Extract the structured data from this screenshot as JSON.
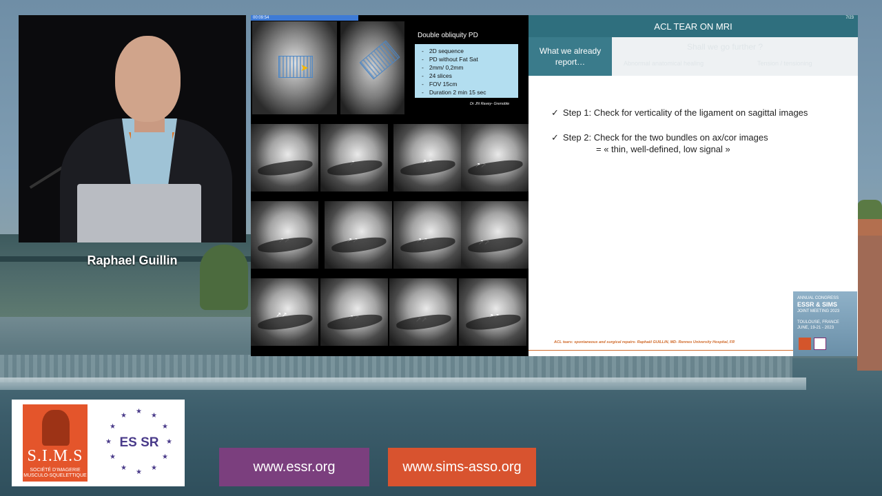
{
  "speaker": {
    "name": "Raphael Guillin"
  },
  "timer": "00:09:54",
  "mri_panel": {
    "caption": "Double obliquity PD",
    "params": [
      "2D sequence",
      "PD without Fat Sat",
      "2mm/ 0,2mm",
      "24 slices",
      "FOV 15cm",
      "Duration 2 min 15 sec"
    ],
    "credit": "Dr JN Ravey- Grenoble"
  },
  "slide": {
    "title": "ACL TEAR ON MRI",
    "counter": "7/23",
    "tab_active": "What we already report…",
    "tab_faded_title": "Shall we go further ?",
    "tab_faded_1": "Abnormal anatomical healing",
    "tab_faded_2": "Tension / tensioning",
    "step1": "Step 1: Check for verticality of the ligament on sagittal images",
    "step2": "Step 2: Check for the two bundles on ax/cor images",
    "step2_sub": "= « thin, well-defined, low signal »",
    "footer": "ACL tears: spontaneous and surgical repairs- Raphaël GUILLIN, MD- Rennes University Hospital, FR"
  },
  "congress": {
    "line1": "ANNUAL CONGRESS",
    "line2": "ESSR & SIMS",
    "line3": "JOINT MEETING 2023",
    "line4": "TOULOUSE, FRANCE",
    "line5": "JUNE, 19-21 - 2023"
  },
  "logos": {
    "sims": "S.I.M.S",
    "sims_sub": "SOCIÉTÉ D'IMAGERIE MUSCULO-SQUELETTIQUE",
    "essr": "ES SR"
  },
  "links": {
    "essr": "www.essr.org",
    "sims": "www.sims-asso.org"
  },
  "colors": {
    "slide_header": "#2f6f7e",
    "tab_active": "#3a7b8b",
    "essr_purple": "#7b3f7e",
    "sims_orange": "#d8532f"
  }
}
